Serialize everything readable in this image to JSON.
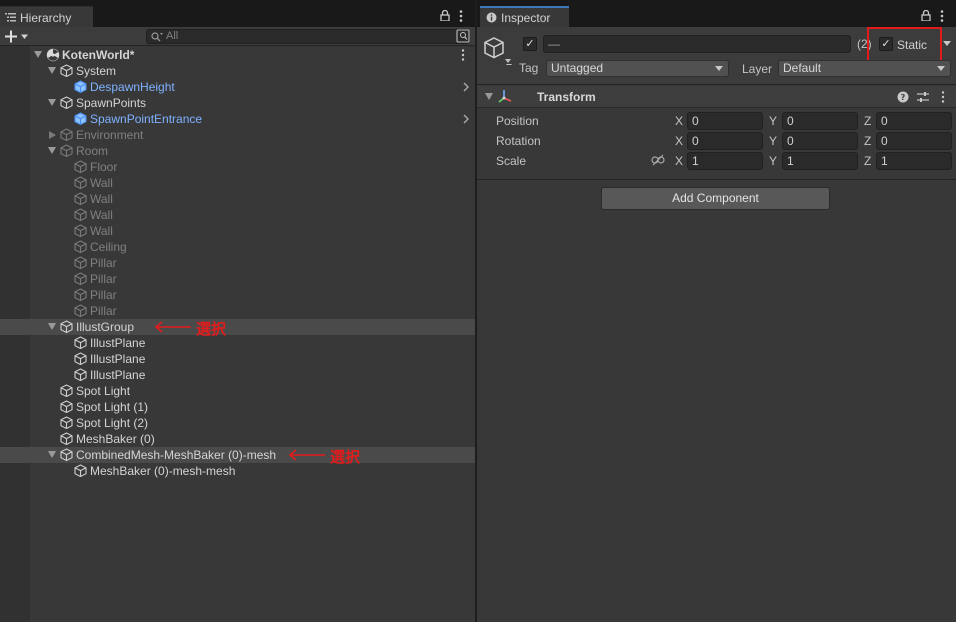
{
  "hierarchy": {
    "tab_label": "Hierarchy",
    "search_placeholder": "All",
    "rows": [
      {
        "label": "KotenWorld*",
        "color": "white",
        "indent": 0,
        "arrow": "down",
        "icon": "scene",
        "bold": true
      },
      {
        "label": "System",
        "color": "white",
        "indent": 1,
        "arrow": "down",
        "icon": "cube"
      },
      {
        "label": "DespawnHeight",
        "color": "blue",
        "indent": 2,
        "arrow": "",
        "icon": "cube-blue",
        "chevron": true
      },
      {
        "label": "SpawnPoints",
        "color": "white",
        "indent": 1,
        "arrow": "down",
        "icon": "cube"
      },
      {
        "label": "SpawnPointEntrance",
        "color": "blue",
        "indent": 2,
        "arrow": "",
        "icon": "cube-blue",
        "chevron": true
      },
      {
        "label": "Environment",
        "color": "gray",
        "indent": 1,
        "arrow": "right",
        "icon": "cube-gray"
      },
      {
        "label": "Room",
        "color": "gray",
        "indent": 1,
        "arrow": "down",
        "icon": "cube-gray"
      },
      {
        "label": "Floor",
        "color": "gray",
        "indent": 2,
        "arrow": "",
        "icon": "cube-gray"
      },
      {
        "label": "Wall",
        "color": "gray",
        "indent": 2,
        "arrow": "",
        "icon": "cube-gray"
      },
      {
        "label": "Wall",
        "color": "gray",
        "indent": 2,
        "arrow": "",
        "icon": "cube-gray"
      },
      {
        "label": "Wall",
        "color": "gray",
        "indent": 2,
        "arrow": "",
        "icon": "cube-gray"
      },
      {
        "label": "Wall",
        "color": "gray",
        "indent": 2,
        "arrow": "",
        "icon": "cube-gray"
      },
      {
        "label": "Ceiling",
        "color": "gray",
        "indent": 2,
        "arrow": "",
        "icon": "cube-gray"
      },
      {
        "label": "Pillar",
        "color": "gray",
        "indent": 2,
        "arrow": "",
        "icon": "cube-gray"
      },
      {
        "label": "Pillar",
        "color": "gray",
        "indent": 2,
        "arrow": "",
        "icon": "cube-gray"
      },
      {
        "label": "Pillar",
        "color": "gray",
        "indent": 2,
        "arrow": "",
        "icon": "cube-gray"
      },
      {
        "label": "Pillar",
        "color": "gray",
        "indent": 2,
        "arrow": "",
        "icon": "cube-gray"
      },
      {
        "label": "IllustGroup",
        "color": "white",
        "indent": 1,
        "arrow": "down",
        "icon": "cube",
        "selected": true,
        "annotation": "選択"
      },
      {
        "label": "IllustPlane",
        "color": "white",
        "indent": 2,
        "arrow": "",
        "icon": "cube"
      },
      {
        "label": "IllustPlane",
        "color": "white",
        "indent": 2,
        "arrow": "",
        "icon": "cube"
      },
      {
        "label": "IllustPlane",
        "color": "white",
        "indent": 2,
        "arrow": "",
        "icon": "cube"
      },
      {
        "label": "Spot Light",
        "color": "white",
        "indent": 1,
        "arrow": "",
        "icon": "cube"
      },
      {
        "label": "Spot Light (1)",
        "color": "white",
        "indent": 1,
        "arrow": "",
        "icon": "cube"
      },
      {
        "label": "Spot Light (2)",
        "color": "white",
        "indent": 1,
        "arrow": "",
        "icon": "cube"
      },
      {
        "label": "MeshBaker (0)",
        "color": "white",
        "indent": 1,
        "arrow": "",
        "icon": "cube"
      },
      {
        "label": "CombinedMesh-MeshBaker (0)-mesh",
        "color": "white",
        "indent": 1,
        "arrow": "down",
        "icon": "cube",
        "selected": true,
        "annotation": "選択"
      },
      {
        "label": "MeshBaker (0)-mesh-mesh",
        "color": "white",
        "indent": 2,
        "arrow": "",
        "icon": "cube"
      }
    ]
  },
  "inspector": {
    "tab_label": "Inspector",
    "object_name": "—",
    "multi_count": "(2)",
    "static_label": "Static",
    "tag_label": "Tag",
    "tag_value": "Untagged",
    "layer_label": "Layer",
    "layer_value": "Default",
    "transform_title": "Transform",
    "props": [
      {
        "label": "Position",
        "x": "0",
        "y": "0",
        "z": "0"
      },
      {
        "label": "Rotation",
        "x": "0",
        "y": "0",
        "z": "0"
      },
      {
        "label": "Scale",
        "x": "1",
        "y": "1",
        "z": "1"
      }
    ],
    "axis_x": "X",
    "axis_y": "Y",
    "axis_z": "Z",
    "add_component": "Add Component"
  },
  "colors": {
    "selection": "#4a4a4a",
    "link_blue": "#7fb2ff",
    "annotation_red": "#e21c1c",
    "tab_accent": "#3a79bb"
  }
}
